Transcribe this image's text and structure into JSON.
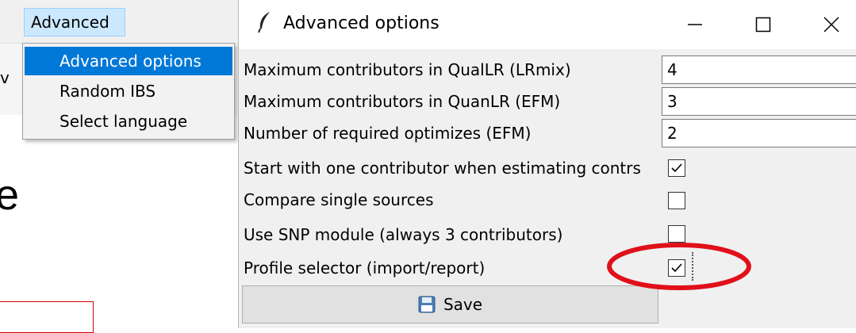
{
  "background_app": {
    "menubar": {
      "advanced_label": "Advanced"
    },
    "toolbar_fragment": "v",
    "large_text_fragment": "e",
    "menu": {
      "items": [
        {
          "label": "Advanced options",
          "selected": true
        },
        {
          "label": "Random IBS",
          "selected": false
        },
        {
          "label": "Select language",
          "selected": false
        }
      ]
    }
  },
  "dialog": {
    "title": "Advanced options",
    "title_icon": "feather-icon",
    "controls": {
      "minimize": "minimize-icon",
      "maximize": "maximize-icon",
      "close": "close-icon"
    },
    "fields": [
      {
        "label": "Maximum contributors in QualLR (LRmix)",
        "value": "4"
      },
      {
        "label": "Maximum contributors in QuanLR (EFM)",
        "value": "3"
      },
      {
        "label": "Number of required optimizes (EFM)",
        "value": "2"
      }
    ],
    "options": [
      {
        "label": "Start with one contributor when estimating contrs",
        "checked": true
      },
      {
        "label": "Compare single sources",
        "checked": false
      },
      {
        "label": "Use SNP module (always 3 contributors)",
        "checked": false
      },
      {
        "label": "Profile selector (import/report)",
        "checked": true
      }
    ],
    "save_label": "Save",
    "save_icon": "floppy-disk-icon"
  },
  "annotation": {
    "type": "red-ellipse-highlight",
    "color": "#e0101a"
  },
  "colors": {
    "menu_highlight": "#0078d7",
    "menubar_highlight": "#cce8ff",
    "dialog_bg": "#f0f0f0",
    "button_bg": "#e1e1e1"
  }
}
